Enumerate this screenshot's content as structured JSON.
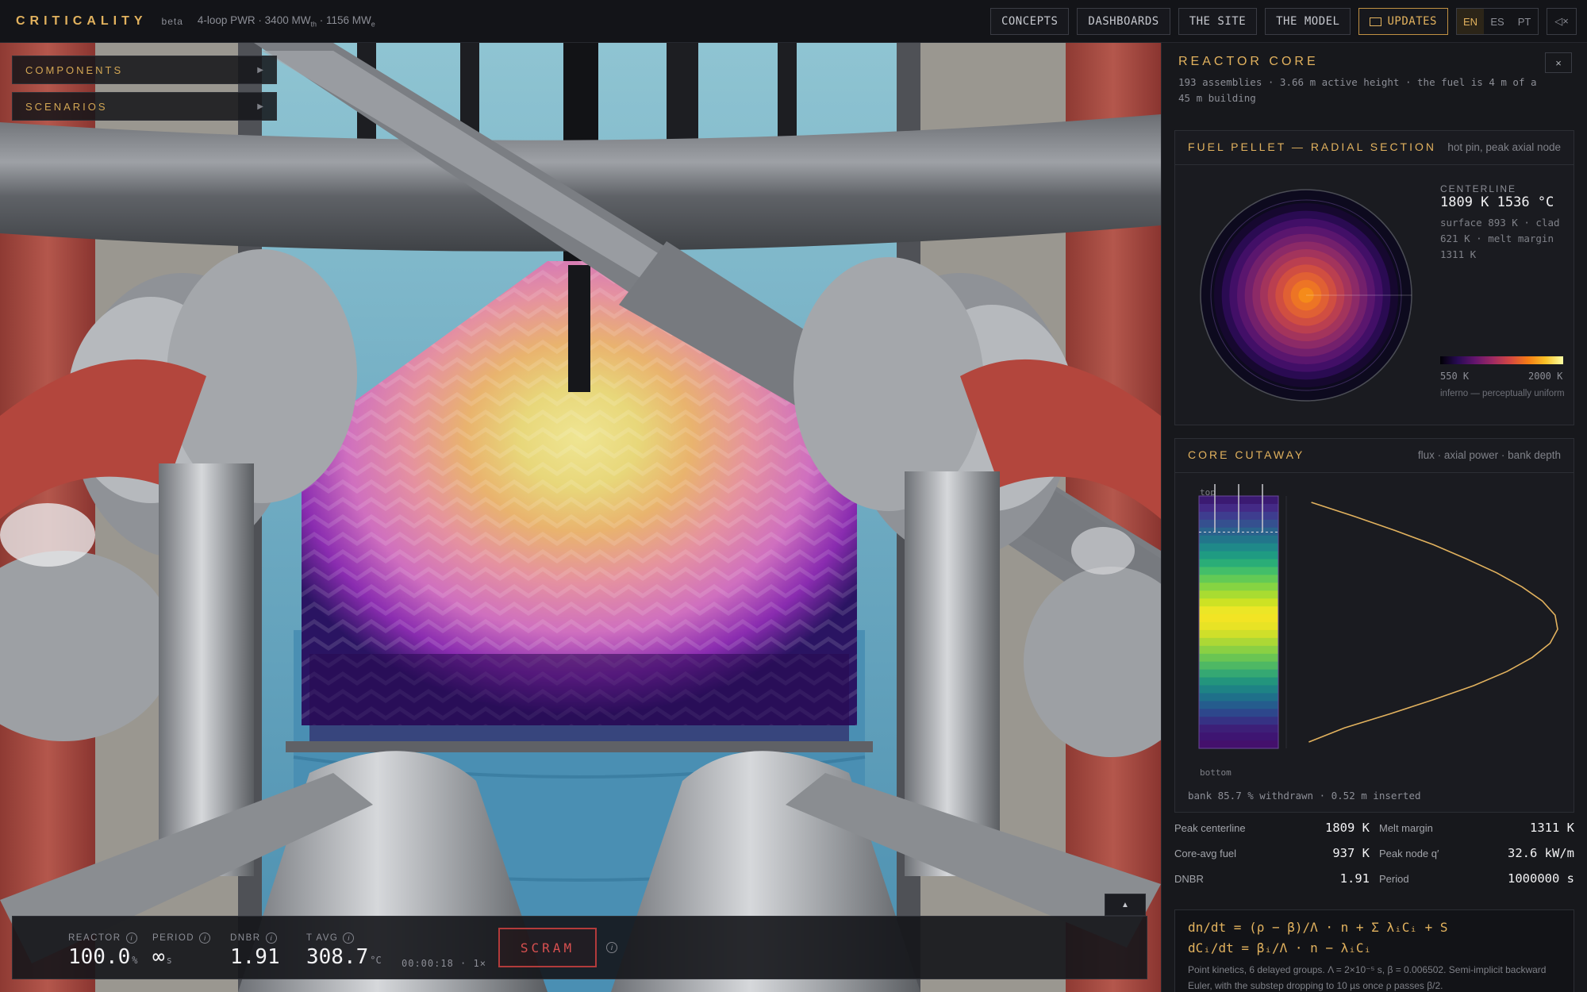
{
  "app": {
    "brand": "CRITICALITY",
    "beta": "beta",
    "subtitle_main": "4-loop PWR · 3400 MW",
    "subtitle_th": "th",
    "subtitle_mid": " · 1156 MW",
    "subtitle_e": "e"
  },
  "nav": {
    "concepts": "CONCEPTS",
    "dashboards": "DASHBOARDS",
    "site": "THE SITE",
    "model": "THE MODEL",
    "updates": "UPDATES",
    "langs": [
      "EN",
      "ES",
      "PT"
    ],
    "active_lang": "EN",
    "mute_icon": "◁×"
  },
  "viewport": {
    "components": "COMPONENTS",
    "scenarios": "SCENARIOS",
    "expand_arrow": "▶",
    "hud_toggle": "▲"
  },
  "hud": {
    "reactor_label": "REACTOR",
    "reactor_value": "100.0",
    "reactor_unit": "%",
    "period_label": "PERIOD",
    "period_value": "∞",
    "period_unit": "s",
    "dnbr_label": "DNBR",
    "dnbr_value": "1.91",
    "tavg_label": "T AVG",
    "tavg_value": "308.7",
    "tavg_unit": "°C",
    "clock": "00:00:18 · 1×",
    "scram": "SCRAM",
    "info_glyph": "i"
  },
  "panel": {
    "title": "REACTOR CORE",
    "subtitle": "193 assemblies · 3.66 m active height · the fuel is 4 m of a 45 m building",
    "close": "×",
    "pellet": {
      "title": "FUEL PELLET — RADIAL SECTION",
      "meta": "hot pin, peak axial node",
      "centerline_label": "CENTERLINE",
      "centerline_value": "1809 K 1536 °C",
      "note": "surface 893 K · clad 621 K · melt margin 1311 K",
      "scale_min": "550 K",
      "scale_max": "2000 K",
      "scale_note": "inferno — perceptually uniform",
      "colors": [
        "#16082f",
        "#2a0b52",
        "#420f67",
        "#5a166e",
        "#73206c",
        "#8c2a67",
        "#a3345c",
        "#ba3f50",
        "#d04e41",
        "#e06034",
        "#ed7425",
        "#f58b1a"
      ]
    },
    "cutaway": {
      "title": "CORE CUTAWAY",
      "meta": "flux · axial power · bank depth",
      "top_label": "top",
      "bottom_label": "bottom",
      "footer": "bank 85.7 % withdrawn · 0.52 m inserted",
      "bank_withdrawn_fraction": 0.857,
      "axial_profile": [
        0.03,
        0.2,
        0.36,
        0.51,
        0.64,
        0.76,
        0.86,
        0.94,
        0.99,
        1.0,
        0.97,
        0.9,
        0.8,
        0.67,
        0.51,
        0.34,
        0.16,
        0.02
      ],
      "band_colors": [
        "#3b1a72",
        "#442a86",
        "#3e3d8f",
        "#35508f",
        "#2b638d",
        "#22758b",
        "#1f8989",
        "#1f9b82",
        "#2aad77",
        "#43be69",
        "#63ca55",
        "#86d442",
        "#a9dc31",
        "#cde224",
        "#ece626",
        "#f2e424",
        "#e8e325",
        "#cfdf2a",
        "#acd835",
        "#8ad043",
        "#6ac553",
        "#4eb864",
        "#35a873",
        "#23957d",
        "#1e8385",
        "#1f708a",
        "#255c8d",
        "#2d478c",
        "#363284",
        "#3d1f78",
        "#3e1572",
        "#44106c"
      ]
    },
    "stats": [
      {
        "k": "Peak centerline",
        "v": "1809  K"
      },
      {
        "k": "Melt margin",
        "v": "1311  K"
      },
      {
        "k": "Core-avg fuel",
        "v": "937  K"
      },
      {
        "k": "Peak node q′",
        "v": "32.6  kW/m"
      },
      {
        "k": "DNBR",
        "v": "1.91"
      },
      {
        "k": "Period",
        "v": "1000000  s"
      }
    ],
    "equations": {
      "eq1": "dn/dt = (ρ − β)/Λ · n + Σ λᵢCᵢ + S",
      "eq2": "dCᵢ/dt = βᵢ/Λ · n − λᵢCᵢ",
      "note": "Point kinetics, 6 delayed groups. Λ = 2×10⁻⁵ s, β = 0.006502. Semi-implicit backward Euler, with the substep dropping to 10 µs once ρ passes β/2."
    }
  }
}
